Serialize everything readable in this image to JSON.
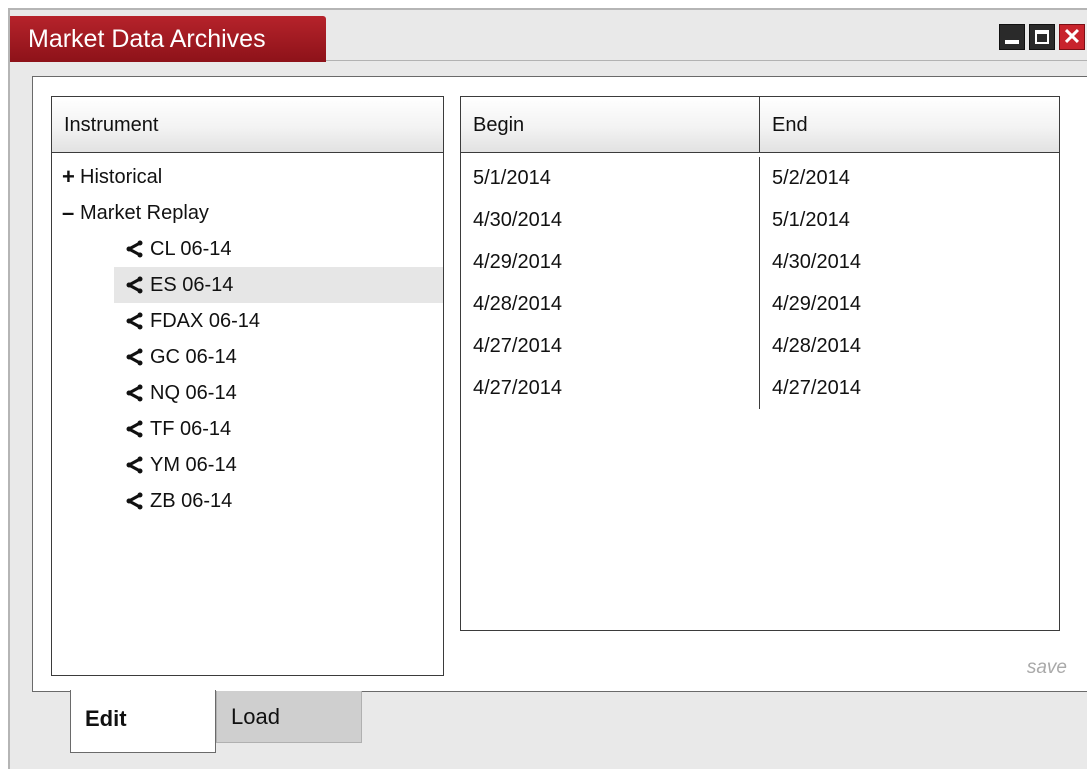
{
  "window": {
    "title": "Market Data Archives",
    "controls": [
      "minimize-icon",
      "maximize-icon",
      "close-icon"
    ],
    "close_glyph": "✕",
    "accent_color": "#a11a22"
  },
  "instrument_panel": {
    "header": "Instrument",
    "tree": [
      {
        "toggle": "+",
        "label": "Historical"
      },
      {
        "toggle": "–",
        "label": "Market Replay"
      }
    ],
    "children": [
      "CL 06-14",
      "ES 06-14",
      "FDAX 06-14",
      "GC 06-14",
      "NQ 06-14",
      "TF 06-14",
      "YM 06-14",
      "ZB 06-14"
    ],
    "selected_child": "ES 06-14"
  },
  "dates_panel": {
    "columns": [
      "Begin",
      "End"
    ],
    "rows": [
      {
        "begin": "5/1/2014",
        "end": "5/2/2014"
      },
      {
        "begin": "4/30/2014",
        "end": "5/1/2014"
      },
      {
        "begin": "4/29/2014",
        "end": "4/30/2014"
      },
      {
        "begin": "4/28/2014",
        "end": "4/29/2014"
      },
      {
        "begin": "4/27/2014",
        "end": "4/28/2014"
      },
      {
        "begin": "4/27/2014",
        "end": "4/27/2014"
      }
    ]
  },
  "save_label": "save",
  "tabs": {
    "edit": "Edit",
    "load": "Load",
    "active": "Edit"
  }
}
